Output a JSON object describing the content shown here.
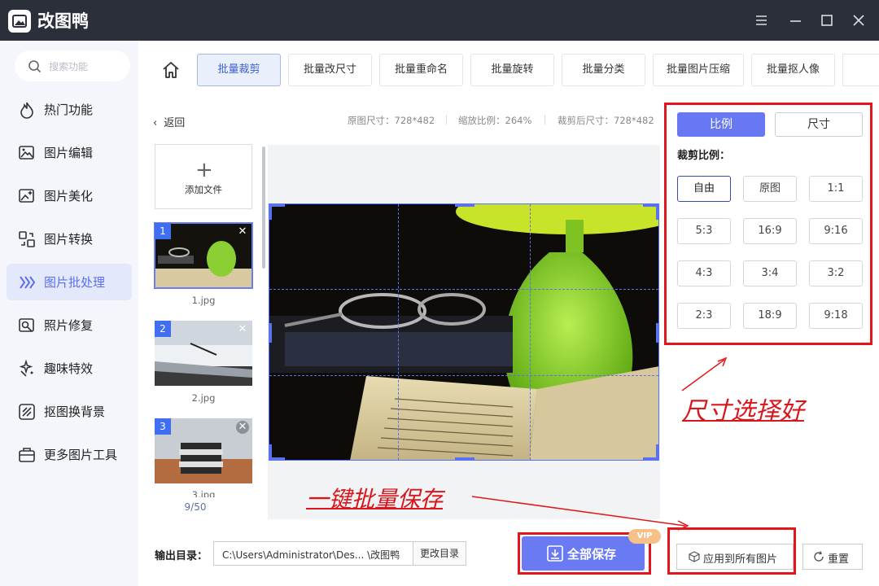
{
  "app": {
    "title": "改图鸭"
  },
  "sidebar": {
    "search_placeholder": "搜索功能",
    "items": [
      {
        "label": "热门功能",
        "icon": "fire-icon"
      },
      {
        "label": "图片编辑",
        "icon": "image-edit-icon"
      },
      {
        "label": "图片美化",
        "icon": "image-beautify-icon"
      },
      {
        "label": "图片转换",
        "icon": "image-convert-icon"
      },
      {
        "label": "图片批处理",
        "icon": "batch-process-icon",
        "active": true
      },
      {
        "label": "照片修复",
        "icon": "photo-repair-icon"
      },
      {
        "label": "趣味特效",
        "icon": "sparkle-icon"
      },
      {
        "label": "抠图换背景",
        "icon": "cutout-icon"
      },
      {
        "label": "更多图片工具",
        "icon": "toolbox-icon"
      }
    ]
  },
  "tabs": [
    "批量裁剪",
    "批量改尺寸",
    "批量重命名",
    "批量旋转",
    "批量分类",
    "批量图片压缩",
    "批量抠人像"
  ],
  "subheader": {
    "back": "返回",
    "original_size": "原图尺寸：728*482",
    "zoom": "缩放比例：264%",
    "cropped_size": "裁剪后尺寸：728*482"
  },
  "files": {
    "add_label": "添加文件",
    "items": [
      {
        "num": "1",
        "name": "1.jpg"
      },
      {
        "num": "2",
        "name": "2.jpg"
      },
      {
        "num": "3",
        "name": "3.jpg"
      }
    ],
    "count": "9/50"
  },
  "panel": {
    "mode_ratio": "比例",
    "mode_size": "尺寸",
    "ratio_title": "裁剪比例：",
    "ratios": [
      "自由",
      "原图",
      "1:1",
      "5:3",
      "16:9",
      "9:16",
      "4:3",
      "3:4",
      "3:2",
      "2:3",
      "18:9",
      "9:18"
    ],
    "selected_ratio": "自由"
  },
  "annotations": {
    "size_note": "尺寸选择好",
    "save_note": "一键批量保存"
  },
  "bottom": {
    "output_label": "输出目录：",
    "output_path": "C:\\Users\\Administrator\\Des... \\改图鸭",
    "change_dir": "更改目录",
    "save_all": "全部保存",
    "vip": "VIP",
    "apply_all": "应用到所有图片",
    "reset": "重置"
  },
  "colors": {
    "accent": "#6a7af3",
    "annotation": "#e0171c",
    "titlebar": "#2b2f3a"
  }
}
